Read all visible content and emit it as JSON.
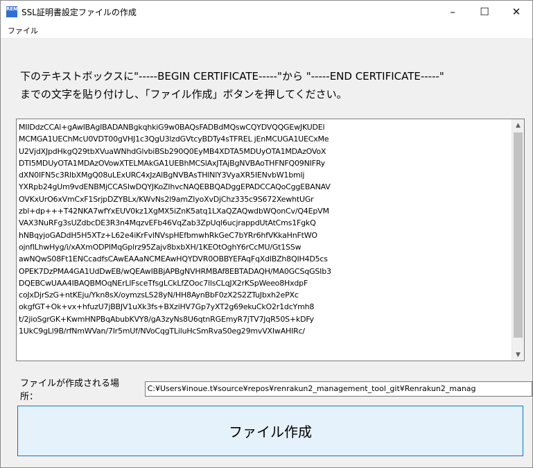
{
  "window": {
    "title": "SSL証明書設定ファイルの作成",
    "icon_text": "REN",
    "controls": {
      "minimize": "–",
      "maximize": "☐",
      "close": "✕"
    }
  },
  "menu": {
    "items": [
      "ファイル"
    ]
  },
  "instructions": {
    "line1": "下のテキストボックスに\"-----BEGIN CERTIFICATE-----\"から \"-----END CERTIFICATE-----\"",
    "line2": "までの文字を貼り付けし、「ファイル作成」ボタンを押してください。"
  },
  "certificate_text": "MIIDdzCCAl+gAwIBAgIBADANBgkqhkiG9w0BAQsFADBdMQswCQYDVQQGEwJKUDEl\nMCMGA1UEChMcU0VDT00gVHJ1c3QgU3lzdGVtcyBDTy4sTFREL jEnMCUGA1UECxMe\nU2VjdXJpdHkgQ29tbXVuaWNhdGlvbiBSb290Q0EyMB4XDTA5MDUyOTA1MDAzOVoX\nDTI5MDUyOTA1MDAzOVowXTELMAkGA1UEBhMCSlAxJTAjBgNVBAoTHFNFQ09NIFRy\ndXN0IFN5c3RlbXMgQ08uLExURC4xJzAlBgNVBAsTHlNlY3VyaXR5IENvbW1bmlj\nYXRpb24gUm9vdENBMjCCASIwDQYJKoZIhvcNAQEBBQADggEPADCCAQoCggEBANAV\nOVKxUrO6xVmCxF1SrjpDZYBLx/KWvNs2l9amZIyoXvDjChz335c9S672XewhtUGr\nzbl+dp+++T42NKA7wfYxEUV0kz1XgMX5iZnK5atq1LXaQZAQwdbWQonCv/Q4EpVM\nVAX3NuRFg3sUZdbcDE3R3n4MqzvEFb46VqZab3ZpUql6ucjrappdUtAtCms1FgkQ\nhNBqyjoGADdH5H5XTz+L62e4iKrFvlNVspHEfbmwhRkGeC7bYRr6hfVKkaHnFtWO\nojnflLhwHyg/i/xAXmODPIMqGplrz95Zajv8bxbXH/1KEOtOghY6rCcMU/Gt1SSw\nawNQwS08Ft1ENCcadfsCAwEAAaNCMEAwHQYDVR0OBBYEFAqFqXdlBZh8QIH4D5cs\nOPEK7DzPMA4GA1UdDwEB/wQEAwIBBjAPBgNVHRMBAf8EBTADAQH/MA0GCSqGSIb3\nDQEBCwUAA4IBAQBMOqNErLlFsceTfsgLCkLfZOoc7llsCLqJX2rKSpWeeo8HxdpF\ncoJxDjrSzG+ntKEju/Ykn8sX/oymzsLS28yN/HH8AynBbF0zX2S2ZTuJbxh2ePXc\nokgfGT+Ok+vx+hfuzU7jBBJV1uXk3fs+BXziHV7Gp7yXT2g69ekuCkO2r1dcYmh8\nt/2jioSgrGK+KwmHNPBqAbubKVY8/gA3zyNs8U6qtnRGEmyR7jTV7JqR50S+kDFy\n1UkC9gLl9B/rfNmWVan/7Ir5mUf/NVoCqgTLiluHcSmRvaS0eg29mvVXIwAHIRc/",
  "location": {
    "label": "ファイルが作成される場所：",
    "path": "C:¥Users¥inoue.t¥source¥repos¥renrakun2_management_tool_git¥Renrakun2_manag"
  },
  "create_button": {
    "label": "ファイル作成"
  },
  "colors": {
    "button_bg": "#e5f1fb",
    "button_border": "#0078d7",
    "thumb": "#c2c2c2"
  }
}
